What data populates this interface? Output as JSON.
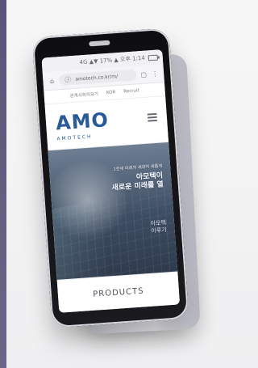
{
  "browser": {
    "status_text": "4G ▲▼ 17% ▲ 오후 1:14",
    "url": "amotech.co.kr/m/"
  },
  "site": {
    "top_links": [
      "관계사회의요기",
      "KOR",
      "Recruit"
    ],
    "logo_main": "AMO",
    "logo_sub": "AMOTECH",
    "hero": {
      "small_text": "1천세 미래의 세대의 새롭게",
      "title_line1": "아모텍이",
      "title_line2": "새로운 미래를 열",
      "right_text": "아모텍\n이루기"
    },
    "products_label": "PRODUCTS"
  },
  "icons": {
    "home": "home-icon",
    "lock": "lock-icon",
    "tabs": "tabs-icon",
    "more": "more-icon",
    "menu": "menu-icon"
  },
  "colors": {
    "brand_blue": "#2a5a97"
  }
}
